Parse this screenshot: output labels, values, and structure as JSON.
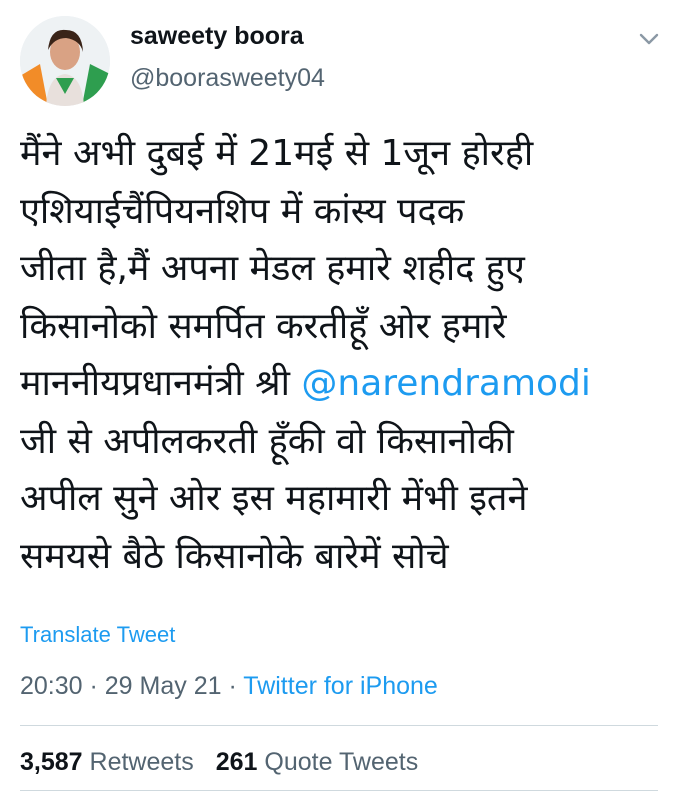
{
  "user": {
    "display_name": "saweety boora",
    "handle": "@boorasweety04"
  },
  "tweet": {
    "lines": [
      "मैंने अभी दुबई में 21मई से 1जून होरही",
      "एशियाईचैंपियनशिप में कांस्य पदक",
      "जीता है,मैं अपना मेडल हमारे शहीद हुए",
      "किसानोको समर्पित करतीहूँ ओर हमारे",
      "माननीयप्रधानमंत्री श्री ",
      "जी से अपीलकरती हूँकी वो किसानोकी",
      "अपील सुने ओर इस महामारी मेंभी इतने",
      "समयसे बैठे किसानोके बारेमें सोचे"
    ],
    "mention": "@narendramodi"
  },
  "translate_label": "Translate Tweet",
  "meta": {
    "time": "20:30",
    "sep1": " · ",
    "date": "29 May 21",
    "sep2": " · ",
    "source": "Twitter for iPhone"
  },
  "stats": {
    "retweets_count": "3,587",
    "retweets_label": "Retweets",
    "quotes_count": "261",
    "quotes_label": "Quote Tweets"
  },
  "colors": {
    "link": "#1d9bf0",
    "secondary": "#536471",
    "primary": "#0f1419"
  },
  "icons": {
    "menu": "chevron-down-icon"
  }
}
